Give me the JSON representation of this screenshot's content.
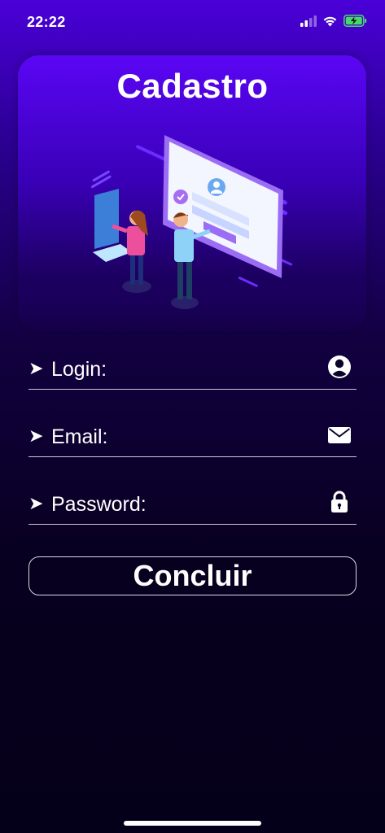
{
  "status": {
    "time": "22:22"
  },
  "page": {
    "title": "Cadastro"
  },
  "fields": [
    {
      "arrow": "➤",
      "label": "Login:",
      "icon": "user-circle-icon"
    },
    {
      "arrow": "➤",
      "label": "Email:",
      "icon": "envelope-icon"
    },
    {
      "arrow": "➤",
      "label": "Password:",
      "icon": "lock-icon"
    }
  ],
  "submit": {
    "label": "Concluir"
  },
  "colors": {
    "primary": "#4a00d8",
    "background": "#05001a",
    "text": "#ffffff"
  }
}
